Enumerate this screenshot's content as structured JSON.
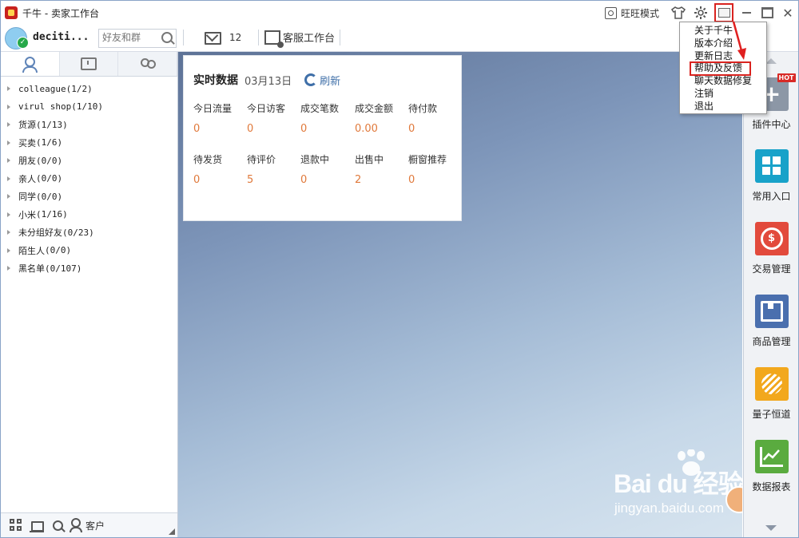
{
  "window": {
    "title": "千牛 - 卖家工作台",
    "wangwang_mode": "旺旺模式"
  },
  "userbar": {
    "username": "deciti...",
    "search_placeholder": "好友和群",
    "message_count": "12",
    "service_workbench": "客服工作台"
  },
  "contact_groups": [
    {
      "label": "colleague",
      "count": "(1/2)",
      "mono": true
    },
    {
      "label": "virul shop",
      "count": "(1/10)",
      "mono": true
    },
    {
      "label": "货源",
      "count": "(1/13)",
      "mono": false
    },
    {
      "label": "买卖",
      "count": "(1/6)",
      "mono": false
    },
    {
      "label": "朋友",
      "count": "(0/0)",
      "mono": false
    },
    {
      "label": "亲人",
      "count": "(0/0)",
      "mono": false
    },
    {
      "label": "同学",
      "count": "(0/0)",
      "mono": false
    },
    {
      "label": "小米",
      "count": "(1/16)",
      "mono": false
    },
    {
      "label": "未分组好友",
      "count": "(0/23)",
      "mono": false
    },
    {
      "label": "陌生人",
      "count": "(0/0)",
      "mono": false
    },
    {
      "label": "黑名单",
      "count": "(0/107)",
      "mono": false
    }
  ],
  "left_bottom": {
    "customer": "客户"
  },
  "realtime": {
    "title": "实时数据",
    "date": "03月13日",
    "refresh": "刷新",
    "row1": [
      {
        "label": "今日流量",
        "value": "0"
      },
      {
        "label": "今日访客",
        "value": "0"
      },
      {
        "label": "成交笔数",
        "value": "0"
      },
      {
        "label": "成交金额",
        "value": "0.00"
      },
      {
        "label": "待付款",
        "value": "0"
      }
    ],
    "row2": [
      {
        "label": "待发货",
        "value": "0"
      },
      {
        "label": "待评价",
        "value": "5"
      },
      {
        "label": "退款中",
        "value": "0"
      },
      {
        "label": "出售中",
        "value": "2"
      },
      {
        "label": "橱窗推荐",
        "value": "0"
      }
    ]
  },
  "sidebar": [
    {
      "label": "插件中心",
      "icon": "plugin-icon",
      "color": "#8c97a6",
      "badge": "HOT"
    },
    {
      "label": "常用入口",
      "icon": "common-entry-icon",
      "color": "#18a2c9"
    },
    {
      "label": "交易管理",
      "icon": "trade-icon",
      "color": "#e24a3c"
    },
    {
      "label": "商品管理",
      "icon": "goods-icon",
      "color": "#4a6fae"
    },
    {
      "label": "量子恒道",
      "icon": "quantum-icon",
      "color": "#f2a81d"
    },
    {
      "label": "数据报表",
      "icon": "report-icon",
      "color": "#5aab3f"
    }
  ],
  "menu": {
    "items": [
      "关于千牛",
      "版本介绍",
      "更新日志",
      "帮助及反馈",
      "聊天数据修复",
      "注销",
      "退出"
    ],
    "highlighted_index": 3
  },
  "watermark": {
    "brand": "Bai du 经验",
    "url": "jingyan.baidu.com"
  }
}
